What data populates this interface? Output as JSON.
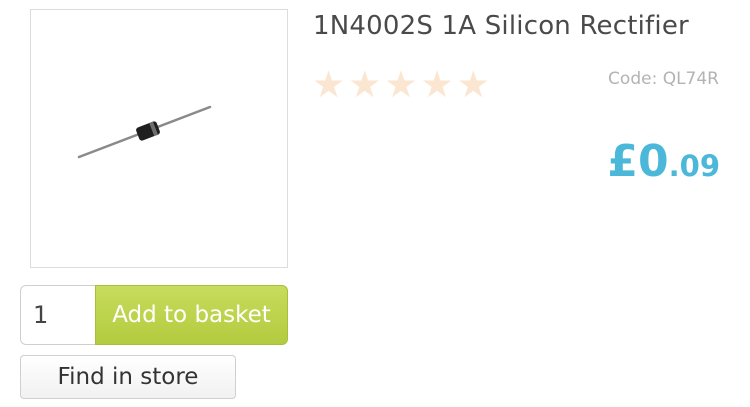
{
  "product": {
    "title": "1N4002S 1A Silicon Rectifier",
    "image_icon": "diode-component",
    "code_text": "Code: QL74R",
    "rating": {
      "filled": 0,
      "max": 5,
      "star_color": "#fbe6d2"
    },
    "price": {
      "main": "£0",
      "pence": ".09",
      "color": "#4bb8d9"
    }
  },
  "purchase": {
    "quantity_value": "1",
    "add_label": "Add to basket",
    "add_color": "#b8cf47",
    "store_label": "Find in store"
  }
}
